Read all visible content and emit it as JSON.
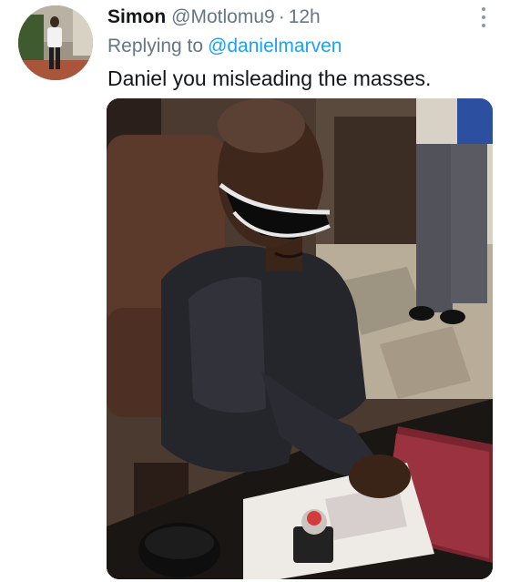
{
  "tweet": {
    "display_name": "Simon",
    "handle": "@Motlomu9",
    "separator": "·",
    "time": "12h",
    "reply_prefix": "Replying to",
    "reply_handle": "@danielmarven",
    "text": "Daniel you misleading the masses."
  },
  "icons": {
    "more": "more-options-icon"
  },
  "colors": {
    "name": "#14171a",
    "secondary": "#657786",
    "link": "#1da1f2",
    "background": "#ffffff"
  }
}
